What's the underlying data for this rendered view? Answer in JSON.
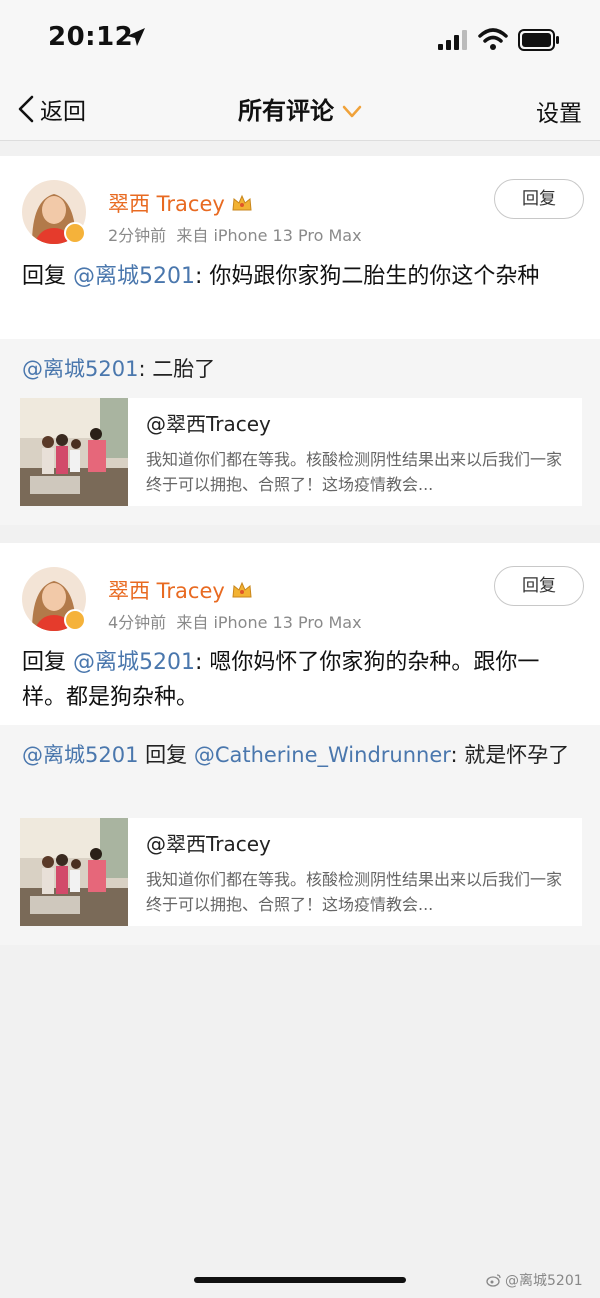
{
  "status_bar": {
    "time": "20:12"
  },
  "nav": {
    "back_label": "返回",
    "title": "所有评论",
    "settings_label": "设置"
  },
  "comments": [
    {
      "author": "翠西 Tracey",
      "time": "2分钟前",
      "source": "来自 iPhone 13 Pro Max",
      "reply_label": "回复",
      "body_prefix": "回复 ",
      "body_mention": "@离城5201",
      "body_text": ": 你妈跟你家狗二胎生的你这个杂种",
      "quote_mention": "@离城5201",
      "quote_text": ": 二胎了",
      "post_author": "@翠西Tracey",
      "post_excerpt": "我知道你们都在等我。核酸检测阴性结果出来以后我们一家终于可以拥抱、合照了！这场疫情教会..."
    },
    {
      "author": "翠西 Tracey",
      "time": "4分钟前",
      "source": "来自 iPhone 13 Pro Max",
      "reply_label": "回复",
      "body_prefix": "回复 ",
      "body_mention": "@离城5201",
      "body_text": ": 嗯你妈怀了你家狗的杂种。跟你一样。都是狗杂种。",
      "quote_mention": "@离城5201",
      "quote_mid": " 回复 ",
      "quote_mention2": "@Catherine_Windrunner",
      "quote_text": ": 就是怀孕了",
      "post_author": "@翠西Tracey",
      "post_excerpt": "我知道你们都在等我。核酸检测阴性结果出来以后我们一家终于可以拥抱、合照了！这场疫情教会..."
    }
  ],
  "watermark": "@离城5201",
  "colors": {
    "author": "#e86a21",
    "mention": "#4a77ad",
    "chevron": "#f0a23a"
  }
}
